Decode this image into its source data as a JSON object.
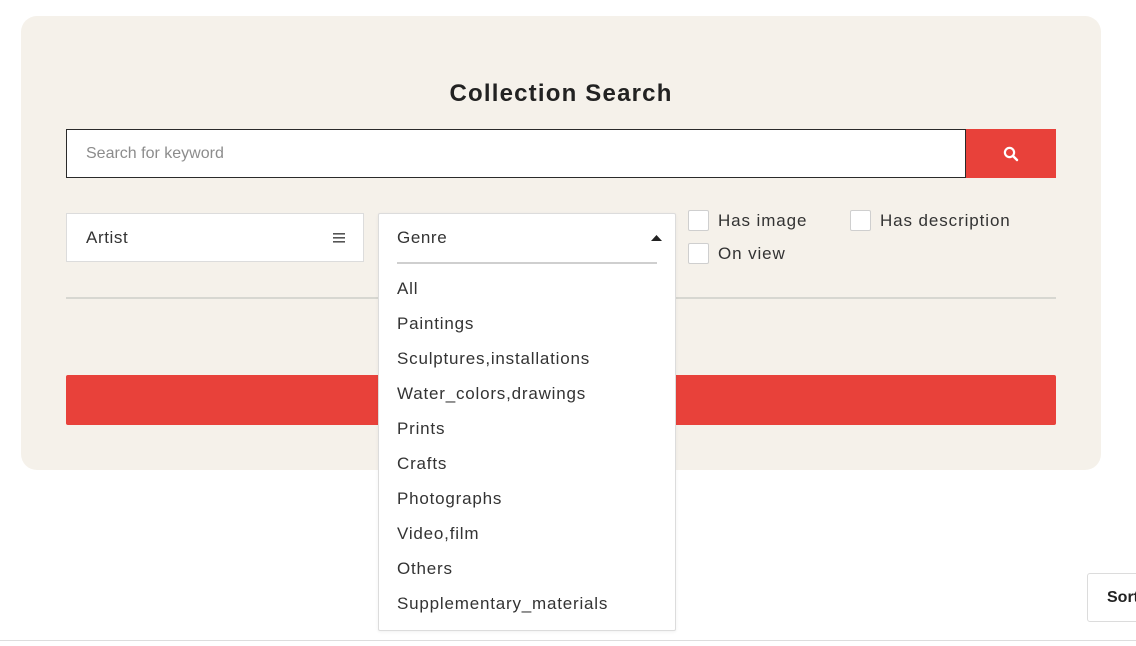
{
  "title": "Collection Search",
  "search": {
    "placeholder": "Search for keyword",
    "value": "",
    "button_icon": "search-icon"
  },
  "filters": {
    "artist": {
      "label": "Artist",
      "icon": "hamburger-icon"
    },
    "genre": {
      "label": "Genre",
      "icon": "caret-up-icon",
      "expanded": true,
      "options": [
        "All",
        "Paintings",
        "Sculptures,installations",
        "Water_colors,drawings",
        "Prints",
        "Crafts",
        "Photographs",
        "Video,film",
        "Others",
        "Supplementary_materials"
      ]
    },
    "checkboxes": {
      "has_image": {
        "label": "Has image",
        "checked": false
      },
      "has_description": {
        "label": "Has description",
        "checked": false
      },
      "on_view": {
        "label": "On view",
        "checked": false
      }
    }
  },
  "submit": {
    "label": ""
  },
  "sort": {
    "label": "Sort"
  },
  "colors": {
    "panel_bg": "#f5f1ea",
    "accent": "#e8413a"
  }
}
